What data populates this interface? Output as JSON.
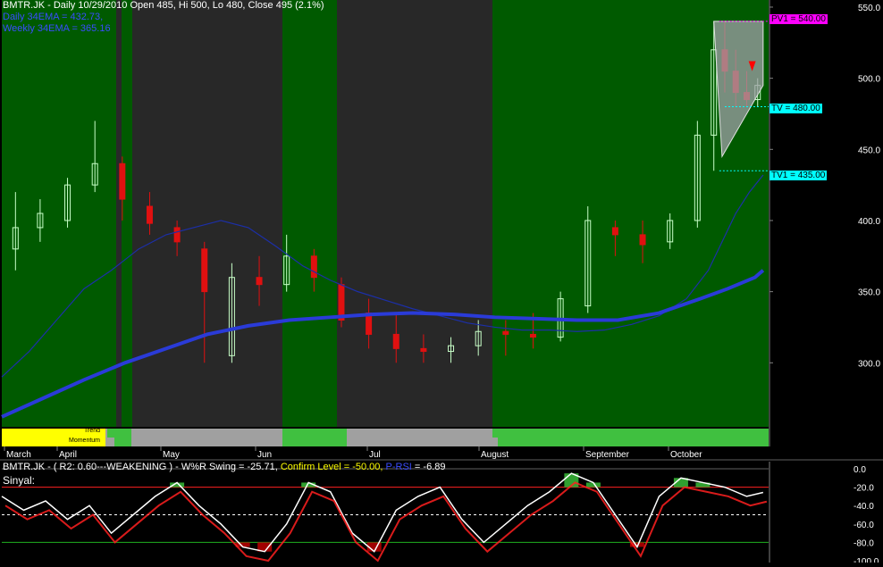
{
  "header": {
    "line1": "BMTR.JK - Daily 10/29/2010 Open 485, Hi 500, Lo 480, Close 495 (2.1%)",
    "line2": "Daily 34EMA = 432.73,",
    "line3": "Weekly 34EMA = 365.16"
  },
  "levels": {
    "pv1": "PV1 = 540.00",
    "tv": "TV = 480.00",
    "tv1": "TV1 = 435.00"
  },
  "strip": {
    "trend": "Trend",
    "momentum": "Momentum"
  },
  "lower": {
    "title_a": "BMTR.JK - ( R2: 0.60---WEAKENING ) - W%R Swing = -25.71,",
    "title_b": " Confirm Level = -50.00,",
    "title_c": " P-RSI",
    "title_d": " = -6.89",
    "sinyal": "Sinyal:"
  },
  "colors": {
    "bull_bg": "#005a00",
    "bear_bg": "#282828",
    "up_candle": "#c8ffc8",
    "down_candle": "#e01010",
    "daily_ema": "#1c2fa8",
    "weekly_ema": "#2a3bd8",
    "pv_box": "#ff00ff",
    "tv_box": "#00ffff",
    "wr_line": "#ffffff",
    "upper_line": "#ff2020",
    "lower_line": "#20b020"
  },
  "chart_data": [
    {
      "type": "candlestick",
      "title": "BMTR.JK - Daily 10/29/2010 Open 485, Hi 500, Lo 480, Close 495 (2.1%)",
      "x_labels": [
        "March",
        "April",
        "May",
        "Jun",
        "Jul",
        "August",
        "September",
        "October"
      ],
      "ylim": [
        255,
        555
      ],
      "y_ticks": [
        "550.0",
        "500.0",
        "450.0",
        "400.0",
        "350.0",
        "300.0"
      ],
      "series": [
        {
          "name": "Daily 34EMA",
          "value_text": "432.73",
          "x": [
            0,
            10,
            20,
            30,
            40,
            50,
            60,
            70,
            80,
            90,
            100,
            110,
            120,
            130,
            140,
            150,
            160,
            170,
            180,
            190,
            200,
            210,
            220,
            230,
            240,
            250,
            258,
            263,
            268,
            273,
            278
          ],
          "values": [
            290,
            308,
            330,
            352,
            365,
            380,
            390,
            395,
            400,
            395,
            382,
            368,
            358,
            350,
            344,
            338,
            333,
            328,
            325,
            323,
            323,
            322,
            323,
            327,
            333,
            345,
            365,
            385,
            405,
            420,
            432
          ]
        },
        {
          "name": "Weekly 34EMA",
          "value_text": "365.16",
          "x": [
            0,
            15,
            30,
            45,
            60,
            75,
            90,
            105,
            120,
            135,
            150,
            165,
            180,
            195,
            210,
            225,
            240,
            255,
            265,
            270,
            275,
            278
          ],
          "values": [
            262,
            275,
            288,
            300,
            310,
            320,
            326,
            330,
            332,
            334,
            335,
            334,
            332,
            331,
            330,
            330,
            335,
            345,
            352,
            356,
            360,
            365
          ]
        },
        {
          "name": "OHLC",
          "x": [
            5,
            14,
            24,
            34,
            44,
            54,
            64,
            74,
            84,
            94,
            104,
            114,
            124,
            134,
            144,
            154,
            164,
            174,
            184,
            194,
            204,
            214,
            224,
            234,
            244,
            254,
            260,
            264,
            268,
            272,
            276
          ],
          "open": [
            380,
            395,
            400,
            425,
            440,
            410,
            395,
            380,
            305,
            360,
            355,
            375,
            355,
            335,
            320,
            310,
            308,
            312,
            322,
            320,
            318,
            340,
            395,
            390,
            385,
            400,
            460,
            520,
            505,
            490,
            485
          ],
          "close": [
            395,
            405,
            425,
            440,
            415,
            398,
            385,
            350,
            360,
            355,
            375,
            360,
            330,
            320,
            310,
            308,
            312,
            322,
            320,
            318,
            345,
            400,
            390,
            383,
            400,
            460,
            520,
            505,
            490,
            485,
            495
          ],
          "high": [
            420,
            415,
            430,
            470,
            445,
            420,
            400,
            385,
            370,
            375,
            390,
            380,
            360,
            345,
            335,
            320,
            318,
            330,
            330,
            335,
            350,
            410,
            400,
            400,
            405,
            470,
            540,
            540,
            520,
            505,
            500
          ],
          "low": [
            365,
            385,
            395,
            420,
            400,
            390,
            375,
            300,
            300,
            340,
            350,
            350,
            325,
            310,
            300,
            300,
            300,
            305,
            305,
            310,
            315,
            335,
            375,
            370,
            380,
            395,
            435,
            490,
            480,
            480,
            480
          ]
        }
      ],
      "annotations": [
        "PV1 = 540.00",
        "TV = 480.00",
        "TV1 = 435.00"
      ]
    },
    {
      "type": "line",
      "title": "BMTR.JK - ( R2: 0.60---WEAKENING ) - W%R Swing = -25.71, Confirm Level = -50.00, P-RSI = -6.89",
      "ylim": [
        -100,
        0
      ],
      "y_ticks": [
        "0.0",
        "-20.0",
        "-40.0",
        "-60.0",
        "-80.0",
        "-100.0"
      ],
      "reference_lines": [
        -20,
        -50,
        -80
      ],
      "series": [
        {
          "name": "W%R Swing",
          "value_text": "-25.71",
          "x": [
            0,
            8,
            16,
            24,
            32,
            40,
            48,
            56,
            64,
            72,
            80,
            88,
            96,
            104,
            112,
            120,
            128,
            136,
            144,
            152,
            160,
            168,
            176,
            184,
            192,
            200,
            208,
            216,
            224,
            232,
            240,
            248,
            256,
            264,
            272,
            278
          ],
          "values": [
            -30,
            -45,
            -35,
            -55,
            -40,
            -70,
            -50,
            -30,
            -15,
            -40,
            -60,
            -85,
            -90,
            -60,
            -15,
            -25,
            -70,
            -90,
            -45,
            -30,
            -20,
            -55,
            -80,
            -60,
            -40,
            -25,
            -5,
            -15,
            -50,
            -85,
            -30,
            -10,
            -15,
            -20,
            -30,
            -25.71
          ]
        }
      ]
    }
  ]
}
